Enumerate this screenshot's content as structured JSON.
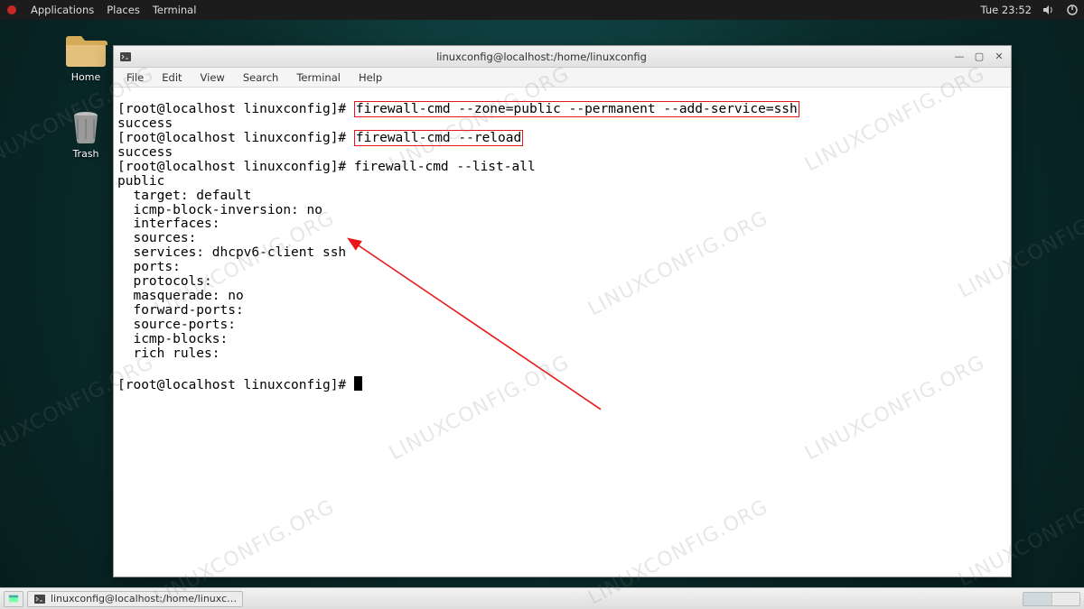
{
  "top_panel": {
    "menus": {
      "applications": "Applications",
      "places": "Places",
      "terminal": "Terminal"
    },
    "clock": "Tue 23:52"
  },
  "desktop_icons": {
    "home": "Home",
    "trash": "Trash"
  },
  "terminal": {
    "title": "linuxconfig@localhost:/home/linuxconfig",
    "menubar": {
      "file": "File",
      "edit": "Edit",
      "view": "View",
      "search": "Search",
      "terminal_m": "Terminal",
      "help": "Help"
    },
    "prompt": "[root@localhost linuxconfig]# ",
    "cmd1": "firewall-cmd --zone=public --permanent --add-service=ssh",
    "out1": "success",
    "cmd2": "firewall-cmd --reload",
    "out2": "success",
    "cmd3": "firewall-cmd --list-all",
    "listall": {
      "zone": "public",
      "l1": "  target: default",
      "l2": "  icmp-block-inversion: no",
      "l3": "  interfaces:",
      "l4": "  sources:",
      "l5": "  services: dhcpv6-client ssh",
      "l6": "  ports:",
      "l7": "  protocols:",
      "l8": "  masquerade: no",
      "l9": "  forward-ports:",
      "l10": "  source-ports:",
      "l11": "  icmp-blocks:",
      "l12": "  rich rules:"
    }
  },
  "bottom_panel": {
    "task_label": "linuxconfig@localhost:/home/linuxc…"
  },
  "watermark_text": "LINUXCONFIG.ORG"
}
